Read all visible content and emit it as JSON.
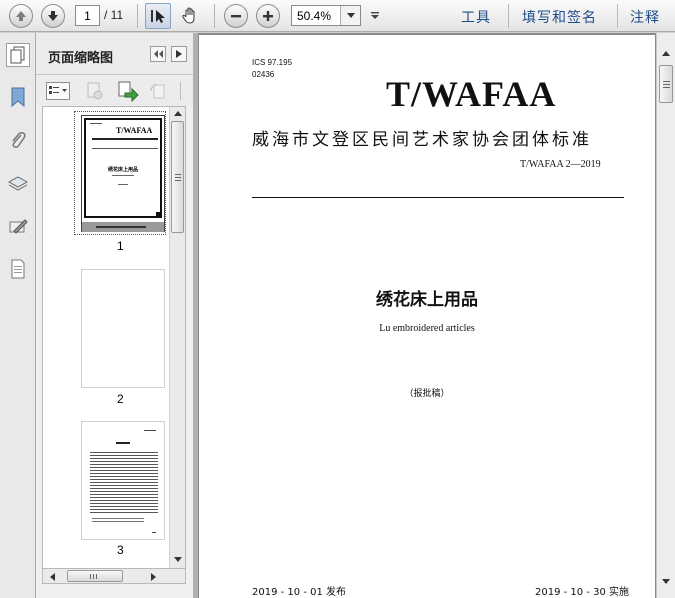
{
  "toolbar": {
    "current_page": "1",
    "total_pages": "/ 11",
    "zoom": "50.4%",
    "tools_label": "工具",
    "sign_label": "填写和签名",
    "comment_label": "注释"
  },
  "panel": {
    "title": "页面缩略图",
    "thumbnails": [
      {
        "number": "1"
      },
      {
        "number": "2"
      },
      {
        "number": "3"
      }
    ]
  },
  "document": {
    "ics": "ICS 97.195",
    "cat_no": "02436",
    "brand": "T/WAFAA",
    "org_title": "威海市文登区民间艺术家协会团体标准",
    "standard_no": "T/WAFAA 2—2019",
    "title_cn": "绣花床上用品",
    "title_en": "Lu embroidered articles",
    "draft": "（报批稿）",
    "publish_date": "2019 - 10 - 01 发布",
    "implement_date": "2019 - 10 - 30 实施"
  },
  "thumb1": {
    "brand": "T/WAFAA",
    "title": "绣花床上用品"
  }
}
